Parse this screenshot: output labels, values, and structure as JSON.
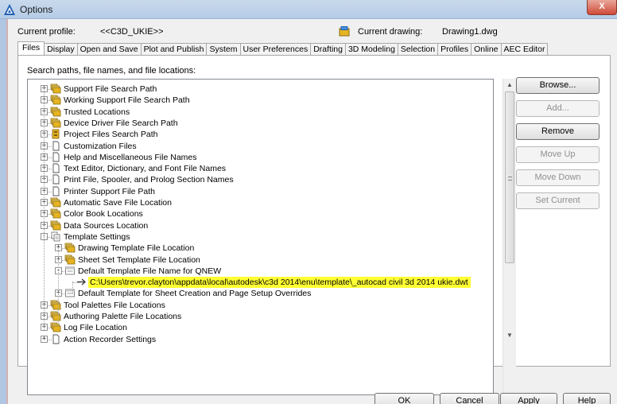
{
  "window": {
    "title": "Options",
    "close_glyph": "X"
  },
  "profile": {
    "current_profile_label": "Current profile:",
    "current_profile_value": "<<C3D_UKIE>>",
    "current_drawing_label": "Current drawing:",
    "current_drawing_value": "Drawing1.dwg"
  },
  "tabs": [
    {
      "label": "Files",
      "active": true
    },
    {
      "label": "Display"
    },
    {
      "label": "Open and Save"
    },
    {
      "label": "Plot and Publish"
    },
    {
      "label": "System"
    },
    {
      "label": "User Preferences"
    },
    {
      "label": "Drafting"
    },
    {
      "label": "3D Modeling"
    },
    {
      "label": "Selection"
    },
    {
      "label": "Profiles"
    },
    {
      "label": "Online"
    },
    {
      "label": "AEC Editor"
    }
  ],
  "files": {
    "search_label": "Search paths, file names, and file locations:",
    "tree": [
      {
        "label": "Support File Search Path",
        "icon": "folder-stack-icon",
        "expander": "+"
      },
      {
        "label": "Working Support File Search Path",
        "icon": "folder-stack-icon",
        "expander": "+"
      },
      {
        "label": "Trusted Locations",
        "icon": "folder-stack-icon",
        "expander": "+"
      },
      {
        "label": "Device Driver File Search Path",
        "icon": "folder-stack-icon",
        "expander": "+"
      },
      {
        "label": "Project Files Search Path",
        "icon": "project-icon",
        "expander": "+"
      },
      {
        "label": "Customization Files",
        "icon": "file-icon",
        "expander": "+"
      },
      {
        "label": "Help and Miscellaneous File Names",
        "icon": "file-icon",
        "expander": "+"
      },
      {
        "label": "Text Editor, Dictionary, and Font File Names",
        "icon": "file-icon",
        "expander": "+"
      },
      {
        "label": "Print File, Spooler, and Prolog Section Names",
        "icon": "file-icon",
        "expander": "+"
      },
      {
        "label": "Printer Support File Path",
        "icon": "file-icon",
        "expander": "+"
      },
      {
        "label": "Automatic Save File Location",
        "icon": "folder-stack-icon",
        "expander": "+"
      },
      {
        "label": "Color Book Locations",
        "icon": "folder-stack-icon",
        "expander": "+"
      },
      {
        "label": "Data Sources Location",
        "icon": "folder-stack-icon",
        "expander": "+"
      },
      {
        "label": "Template Settings",
        "icon": "template-icon",
        "expander": "-"
      },
      {
        "label": "Drawing Template File Location",
        "icon": "folder-stack-icon",
        "expander": "+"
      },
      {
        "label": "Sheet Set Template File Location",
        "icon": "folder-stack-icon",
        "expander": "+"
      },
      {
        "label": "Default Template File Name for QNEW",
        "icon": "dwt-icon",
        "expander": "-"
      },
      {
        "label": "C:\\Users\\trevor.clayton\\appdata\\local\\autodesk\\c3d 2014\\enu\\template\\_autocad civil 3d 2014 ukie.dwt",
        "icon": "arrow-icon",
        "expander": ""
      },
      {
        "label": "Default Template for Sheet Creation and Page Setup Overrides",
        "icon": "dwt-icon",
        "expander": "+"
      },
      {
        "label": "Tool Palettes File Locations",
        "icon": "folder-stack-icon",
        "expander": "+"
      },
      {
        "label": "Authoring Palette File Locations",
        "icon": "folder-stack-icon",
        "expander": "+"
      },
      {
        "label": "Log File Location",
        "icon": "folder-stack-icon",
        "expander": "+"
      },
      {
        "label": "Action Recorder Settings",
        "icon": "file-icon",
        "expander": "+"
      }
    ],
    "buttons": {
      "browse": "Browse...",
      "add": "Add...",
      "remove": "Remove",
      "move_up": "Move Up",
      "move_down": "Move Down",
      "set_current": "Set Current"
    }
  },
  "footer": {
    "ok": "OK",
    "cancel": "Cancel",
    "apply": "Apply",
    "help": "Help"
  },
  "colors": {
    "highlight": "#ffff33",
    "folder": "#e6b422",
    "accent": "#1f5fb4"
  }
}
